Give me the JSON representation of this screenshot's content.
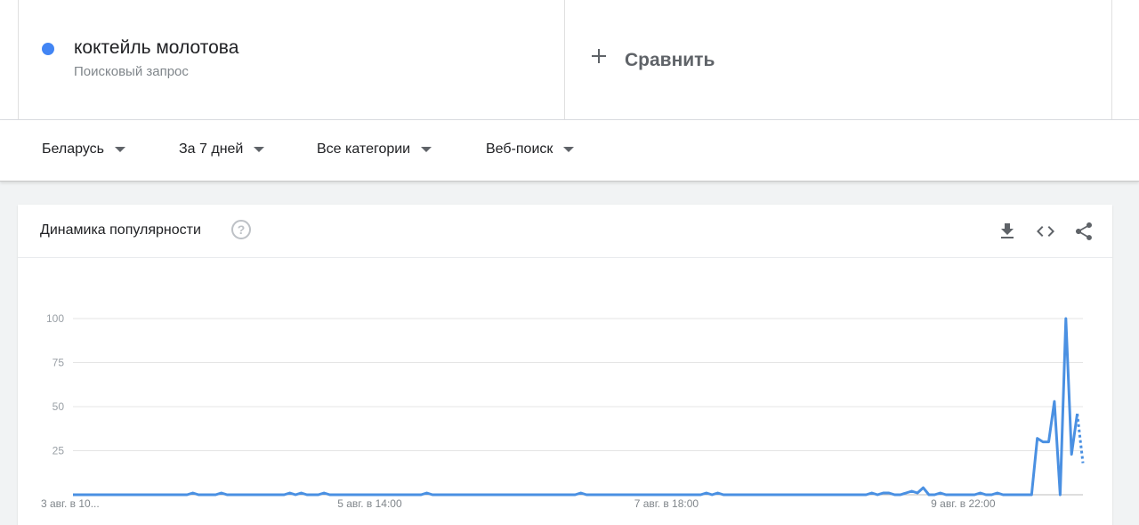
{
  "search_term": {
    "title": "коктейль молотова",
    "subtitle": "Поисковый запрос",
    "color": "#4285f4"
  },
  "compare": {
    "label": "Сравнить",
    "icon": "plus-icon"
  },
  "filters": [
    {
      "label": "Беларусь"
    },
    {
      "label": "За 7 дней"
    },
    {
      "label": "Все категории"
    },
    {
      "label": "Веб-поиск"
    }
  ],
  "card": {
    "title": "Динамика популярности",
    "help_icon": "question-icon",
    "actions": [
      "download-icon",
      "embed-code-icon",
      "share-icon"
    ]
  },
  "chart_data": {
    "type": "line",
    "line_color": "#4a90e2",
    "ylim": [
      0,
      100
    ],
    "y_ticks": [
      25,
      50,
      75,
      100
    ],
    "x_ticks": [
      "3 авг. в 10...",
      "5 авг. в 14:00",
      "7 авг. в 18:00",
      "9 авг. в 22:00"
    ],
    "x_tick_index": [
      0,
      52,
      104,
      156
    ],
    "grid": true,
    "series": [
      {
        "values": [
          0,
          0,
          0,
          0,
          0,
          0,
          0,
          0,
          0,
          0,
          0,
          0,
          0,
          0,
          0,
          0,
          0,
          0,
          0,
          0,
          0,
          1,
          0,
          0,
          0,
          0,
          1,
          0,
          0,
          0,
          0,
          0,
          0,
          0,
          0,
          0,
          0,
          0,
          1,
          0,
          1,
          0,
          0,
          0,
          1,
          0,
          0,
          0,
          0,
          0,
          0,
          0,
          0,
          0,
          0,
          0,
          0,
          0,
          0,
          0,
          0,
          0,
          1,
          0,
          0,
          0,
          0,
          0,
          0,
          0,
          0,
          0,
          0,
          0,
          0,
          0,
          0,
          0,
          0,
          0,
          0,
          0,
          0,
          0,
          0,
          0,
          0,
          0,
          0,
          1,
          0,
          0,
          0,
          0,
          0,
          0,
          0,
          0,
          0,
          0,
          0,
          0,
          0,
          0,
          0,
          0,
          0,
          0,
          0,
          0,
          0,
          1,
          0,
          1,
          0,
          0,
          0,
          0,
          0,
          0,
          0,
          0,
          0,
          0,
          0,
          0,
          0,
          0,
          0,
          0,
          0,
          0,
          0,
          0,
          0,
          0,
          0,
          0,
          0,
          0,
          1,
          0,
          1,
          1,
          0,
          0,
          1,
          2,
          1,
          4,
          0,
          0,
          1,
          0,
          0,
          0,
          0,
          0,
          0,
          1,
          0,
          0,
          1,
          0,
          0,
          0,
          0,
          0,
          0,
          32,
          30,
          30,
          53,
          0,
          100,
          23,
          46
        ],
        "partial_values": [
          46,
          18
        ]
      }
    ]
  }
}
